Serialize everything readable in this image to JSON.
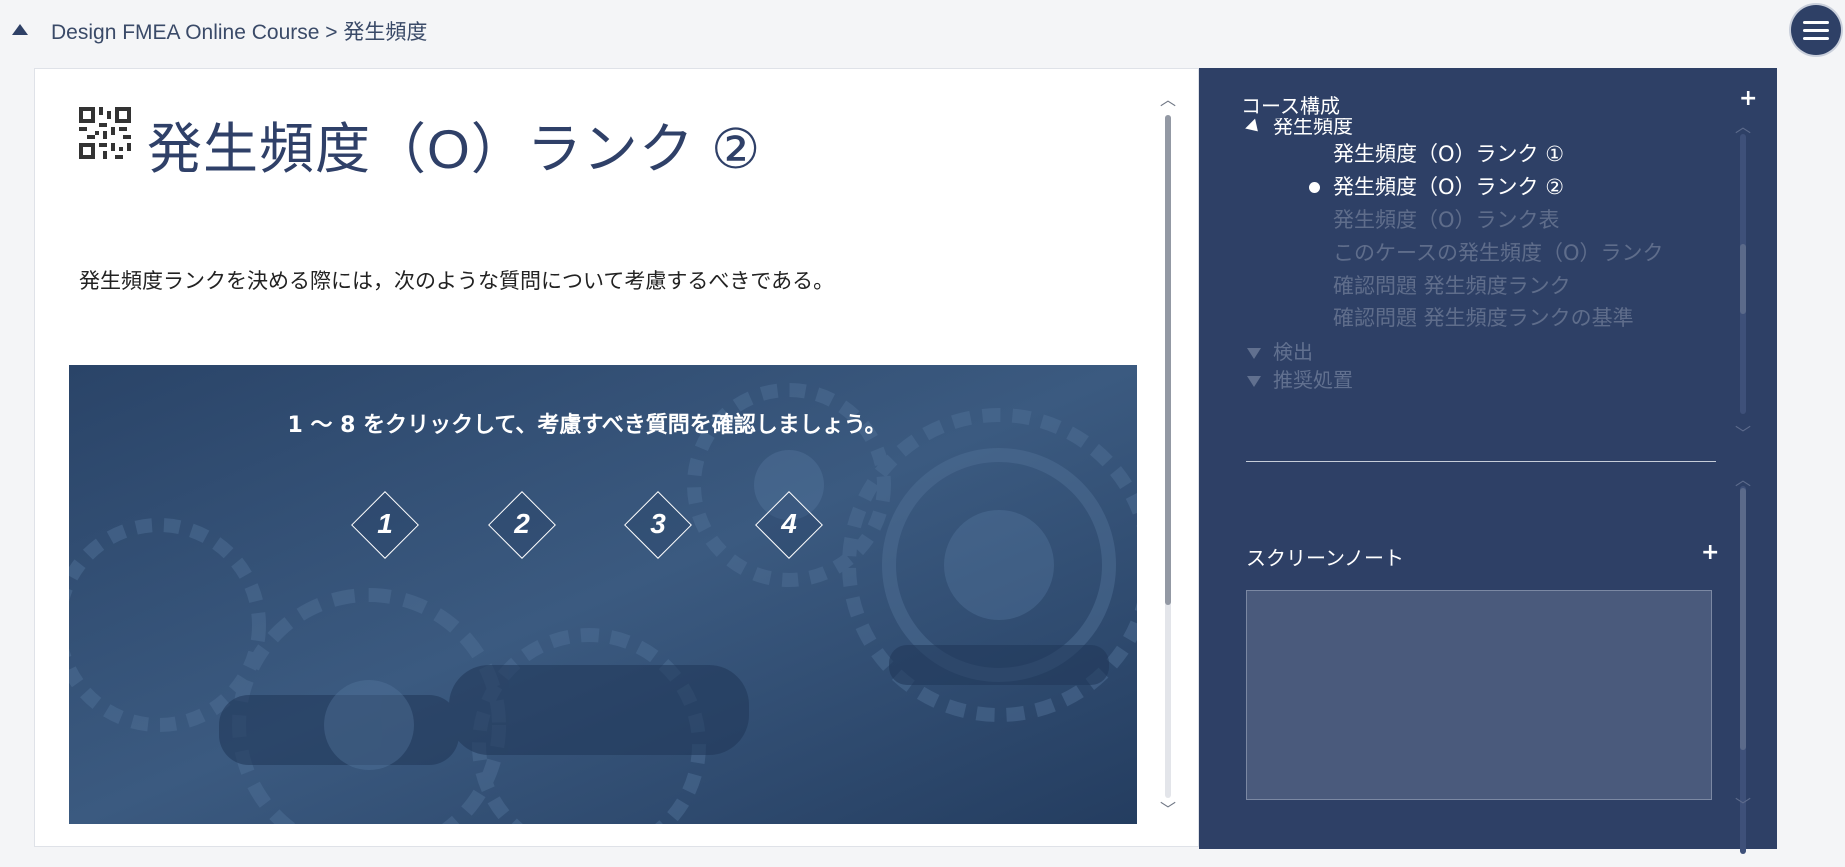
{
  "breadcrumb": {
    "text": "Design FMEA Online Course > 発生頻度"
  },
  "page": {
    "title": "発生頻度（O）ランク ②",
    "body": "発生頻度ランクを決める際には，次のような質問について考慮するべきである。"
  },
  "hero": {
    "instruction": "1 ～ 8 をクリックして、考慮すべき質問を確認しましょう。",
    "buttons": [
      "1",
      "2",
      "3",
      "4"
    ]
  },
  "outline": {
    "header": "コース構成",
    "add_label": "+",
    "current_section": "発生頻度",
    "lessons": [
      {
        "label": "発生頻度（O）ランク ①",
        "state": "visited"
      },
      {
        "label": "発生頻度（O）ランク ②",
        "state": "current"
      },
      {
        "label": "発生頻度（O）ランク表",
        "state": "locked"
      },
      {
        "label": "このケースの発生頻度（O）ランク",
        "state": "locked"
      },
      {
        "label": "確認問題 発生頻度ランク",
        "state": "locked"
      },
      {
        "label": "確認問題 発生頻度ランクの基準",
        "state": "locked"
      }
    ],
    "sections": [
      {
        "label": "検出"
      },
      {
        "label": "推奨処置"
      }
    ]
  },
  "notes": {
    "header": "スクリーンノート",
    "add_label": "+",
    "value": ""
  },
  "colors": {
    "sidebar_bg": "#2e4066",
    "title_color": "#2f4068",
    "hero_bg": "#2c4a6f",
    "dim_text": "#5f6d8b"
  }
}
